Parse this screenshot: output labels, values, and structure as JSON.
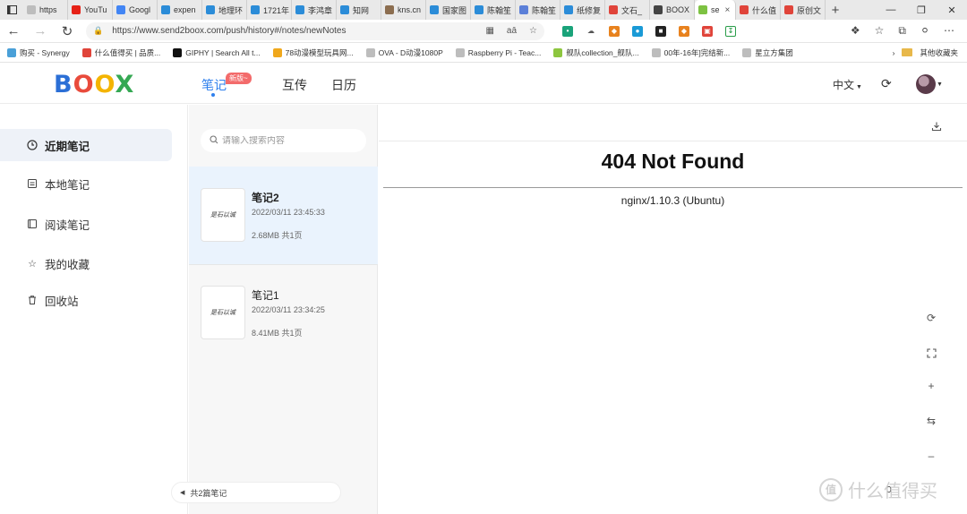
{
  "browser": {
    "tabs": [
      {
        "label": "https",
        "fav": "page-icon",
        "color": "#bdbdbd"
      },
      {
        "label": "YouTu",
        "fav": "youtube-icon",
        "color": "#e62117"
      },
      {
        "label": "Googl",
        "fav": "google-icon",
        "color": "#4285f4"
      },
      {
        "label": "expen",
        "fav": "bing-icon",
        "color": "#2b8cd8"
      },
      {
        "label": "地理环",
        "fav": "bing-icon",
        "color": "#2b8cd8"
      },
      {
        "label": "1721年",
        "fav": "bing-icon",
        "color": "#2b8cd8"
      },
      {
        "label": "李鸿章",
        "fav": "bing-icon",
        "color": "#2b8cd8"
      },
      {
        "label": "知网",
        "fav": "bing-icon",
        "color": "#2b8cd8"
      },
      {
        "label": "kns.cn",
        "fav": "cnki-icon",
        "color": "#8b6d4f"
      },
      {
        "label": "国家图",
        "fav": "bing-icon",
        "color": "#2b8cd8"
      },
      {
        "label": "陈翰笙",
        "fav": "bing-icon",
        "color": "#2b8cd8"
      },
      {
        "label": "陈翰笙",
        "fav": "globe-icon",
        "color": "#5b7fd8"
      },
      {
        "label": "纸修复",
        "fav": "bing-icon",
        "color": "#2b8cd8"
      },
      {
        "label": "文石_",
        "fav": "smzdm-icon",
        "color": "#e0443a"
      },
      {
        "label": "BOOX",
        "fav": "boox-icon",
        "color": "#444444"
      },
      {
        "label": "se",
        "fav": "send2boox-icon",
        "color": "#7dc242",
        "active": true
      },
      {
        "label": "什么值",
        "fav": "smzdm-icon",
        "color": "#e0443a"
      },
      {
        "label": "原创文",
        "fav": "smzdm-icon",
        "color": "#e0443a"
      }
    ],
    "url": "https://www.send2boox.com/push/history#/notes/newNotes",
    "bookmarks": [
      {
        "label": "购买 - Synergy",
        "color": "#4aa0d8"
      },
      {
        "label": "什么值得买 | 品质...",
        "color": "#e0443a"
      },
      {
        "label": "GIPHY | Search All t...",
        "color": "#111111"
      },
      {
        "label": "78动漫模型玩具网...",
        "color": "#f0a81c"
      },
      {
        "label": "OVA - D动漫1080P",
        "color": "#bdbdbd"
      },
      {
        "label": "Raspberry Pi - Teac...",
        "color": "#bdbdbd"
      },
      {
        "label": "舰队collection_舰队...",
        "color": "#8dc63f"
      },
      {
        "label": "00年-16年]完结新...",
        "color": "#bdbdbd"
      },
      {
        "label": "星立方集团",
        "color": "#bdbdbd"
      }
    ],
    "other_bookmarks": "其他收藏夹"
  },
  "header": {
    "logo": {
      "b": "B",
      "o1": "O",
      "o2": "O",
      "x": "X"
    },
    "nav": {
      "notes": "笔记",
      "badge": "新版~",
      "interact": "互传",
      "calendar": "日历"
    },
    "lang": "中文",
    "accent": "#2f80ed"
  },
  "sidebar": {
    "items": [
      {
        "label": "近期笔记",
        "icon": "clock-icon"
      },
      {
        "label": "本地笔记",
        "icon": "note-icon"
      },
      {
        "label": "阅读笔记",
        "icon": "book-icon"
      },
      {
        "label": "我的收藏",
        "icon": "star-icon"
      },
      {
        "label": "回收站",
        "icon": "trash-icon"
      }
    ]
  },
  "notelist": {
    "search_placeholder": "请输入搜索内容",
    "notes": [
      {
        "title": "笔记2",
        "date": "2022/03/11 23:45:33",
        "meta": "2.68MB  共1页",
        "thumb": "是石以诚"
      },
      {
        "title": "笔记1",
        "date": "2022/03/11 23:34:25",
        "meta": "8.41MB  共1页",
        "thumb": "是石以诚"
      }
    ],
    "count": "共2篇笔记"
  },
  "content": {
    "error_title": "404 Not Found",
    "server": "nginx/1.10.3 (Ubuntu)",
    "stray": "0"
  },
  "watermark": {
    "logo": "值",
    "text": "什么值得买"
  }
}
